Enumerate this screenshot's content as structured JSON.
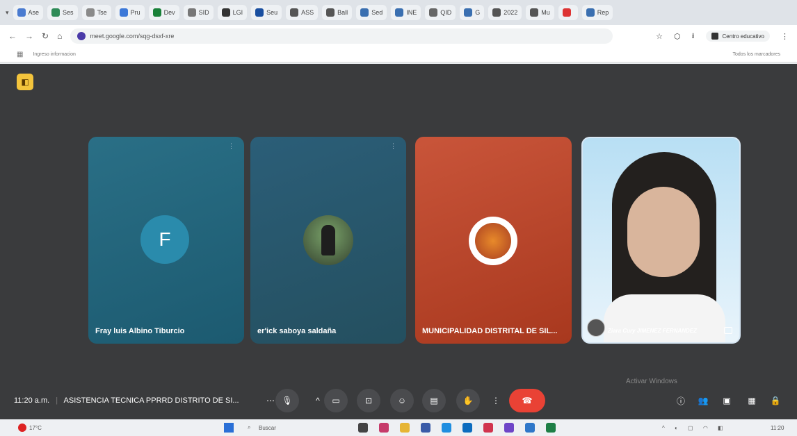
{
  "browser": {
    "tabs": [
      {
        "label": "Ase",
        "color": "#4a7bd0"
      },
      {
        "label": "Ses",
        "color": "#2e8b57"
      },
      {
        "label": "Tse",
        "color": "#8a8a8a"
      },
      {
        "label": "Pru",
        "color": "#3c78d8"
      },
      {
        "label": "Dev",
        "color": "#188038"
      },
      {
        "label": "SID",
        "color": "#777"
      },
      {
        "label": "LGI",
        "color": "#333"
      },
      {
        "label": "Seu",
        "color": "#1a4fa0"
      },
      {
        "label": "ASS",
        "color": "#555"
      },
      {
        "label": "Ball",
        "color": "#555"
      },
      {
        "label": "Sed",
        "color": "#3a6fb0"
      },
      {
        "label": "INE",
        "color": "#3a6fb0"
      },
      {
        "label": "QID",
        "color": "#666"
      },
      {
        "label": "G",
        "color": "#3a6fb0"
      },
      {
        "label": "2022",
        "color": "#555"
      },
      {
        "label": "Mu",
        "color": "#555"
      },
      {
        "label": "",
        "color": "#d33"
      },
      {
        "label": "Rep",
        "color": "#3a6fb0"
      }
    ],
    "url": "meet.google.com/sqg-dsxf-xre",
    "profile_label": "Centro educativo",
    "bookmark": "Ingreso informacion",
    "all_bookmarks": "Todos los marcadores"
  },
  "meeting": {
    "time": "11:20 a.m.",
    "title": "ASISTENCIA TECNICA PPRRD DISTRITO DE SI...",
    "participants": [
      {
        "name": "Fray luis Albino Tiburcio",
        "initial": "F"
      },
      {
        "name": "er'ick saboya saldaña"
      },
      {
        "name": "MUNICIPALIDAD DISTRITAL DE SIL..."
      },
      {
        "name": "Ziara Cury JIMENEZ FERNANDEZ"
      }
    ],
    "activate_windows": "Activar Windows"
  },
  "taskbar": {
    "weather": "17°C",
    "search": "Buscar",
    "clock": "11:20"
  }
}
